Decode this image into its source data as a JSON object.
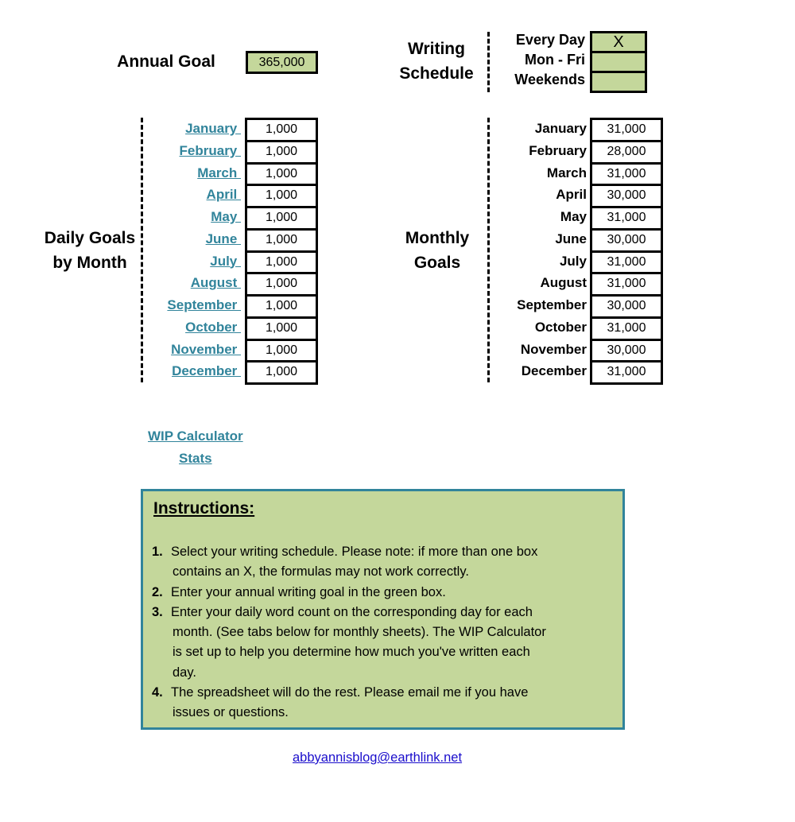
{
  "annual_goal": {
    "label": "Annual Goal",
    "value": "365,000"
  },
  "writing_schedule": {
    "label_line1": "Writing",
    "label_line2": "Schedule",
    "options": [
      {
        "label": "Every Day",
        "mark": "X"
      },
      {
        "label": "Mon - Fri",
        "mark": ""
      },
      {
        "label": "Weekends",
        "mark": ""
      }
    ]
  },
  "daily_goals": {
    "label_line1": "Daily Goals",
    "label_line2": "by Month",
    "rows": [
      {
        "month": "January ",
        "value": "1,000"
      },
      {
        "month": "February ",
        "value": "1,000"
      },
      {
        "month": "March ",
        "value": "1,000"
      },
      {
        "month": "April ",
        "value": "1,000"
      },
      {
        "month": "May ",
        "value": "1,000"
      },
      {
        "month": "June ",
        "value": "1,000"
      },
      {
        "month": "July ",
        "value": "1,000"
      },
      {
        "month": "August ",
        "value": "1,000"
      },
      {
        "month": "September ",
        "value": "1,000"
      },
      {
        "month": "October ",
        "value": "1,000"
      },
      {
        "month": "November ",
        "value": "1,000"
      },
      {
        "month": "December ",
        "value": "1,000"
      }
    ]
  },
  "monthly_goals": {
    "label_line1": "Monthly",
    "label_line2": "Goals",
    "rows": [
      {
        "month": "January",
        "value": "31,000"
      },
      {
        "month": "February",
        "value": "28,000"
      },
      {
        "month": "March",
        "value": "31,000"
      },
      {
        "month": "April",
        "value": "30,000"
      },
      {
        "month": "May",
        "value": "31,000"
      },
      {
        "month": "June",
        "value": "30,000"
      },
      {
        "month": "July",
        "value": "31,000"
      },
      {
        "month": "August",
        "value": "31,000"
      },
      {
        "month": "September",
        "value": "30,000"
      },
      {
        "month": "October",
        "value": "31,000"
      },
      {
        "month": "November",
        "value": "30,000"
      },
      {
        "month": "December",
        "value": "31,000"
      }
    ]
  },
  "links": {
    "wip_calculator": "WIP Calculator",
    "stats": "Stats",
    "email": "abbyannisblog@earthlink.net"
  },
  "instructions": {
    "title": "Instructions:",
    "items": [
      {
        "num": "1.",
        "lines": [
          "Select your writing schedule. Please note: if more than one box",
          "contains an X, the formulas may not work correctly."
        ]
      },
      {
        "num": "2.",
        "lines": [
          "Enter your annual writing goal in the green box."
        ]
      },
      {
        "num": "3.",
        "lines": [
          "Enter your daily word count on the corresponding day for each",
          "month. (See tabs below for monthly sheets). The WIP Calculator",
          "is set up to help you determine how much you've written each",
          "day."
        ]
      },
      {
        "num": "4.",
        "lines": [
          "The spreadsheet will do the rest. Please email me if you have",
          "issues or questions."
        ]
      }
    ]
  },
  "colors": {
    "input_green": "#c4d79b",
    "link_teal": "#31849b",
    "instructions_border": "#31849b",
    "email_link": "#1a0dcc"
  }
}
